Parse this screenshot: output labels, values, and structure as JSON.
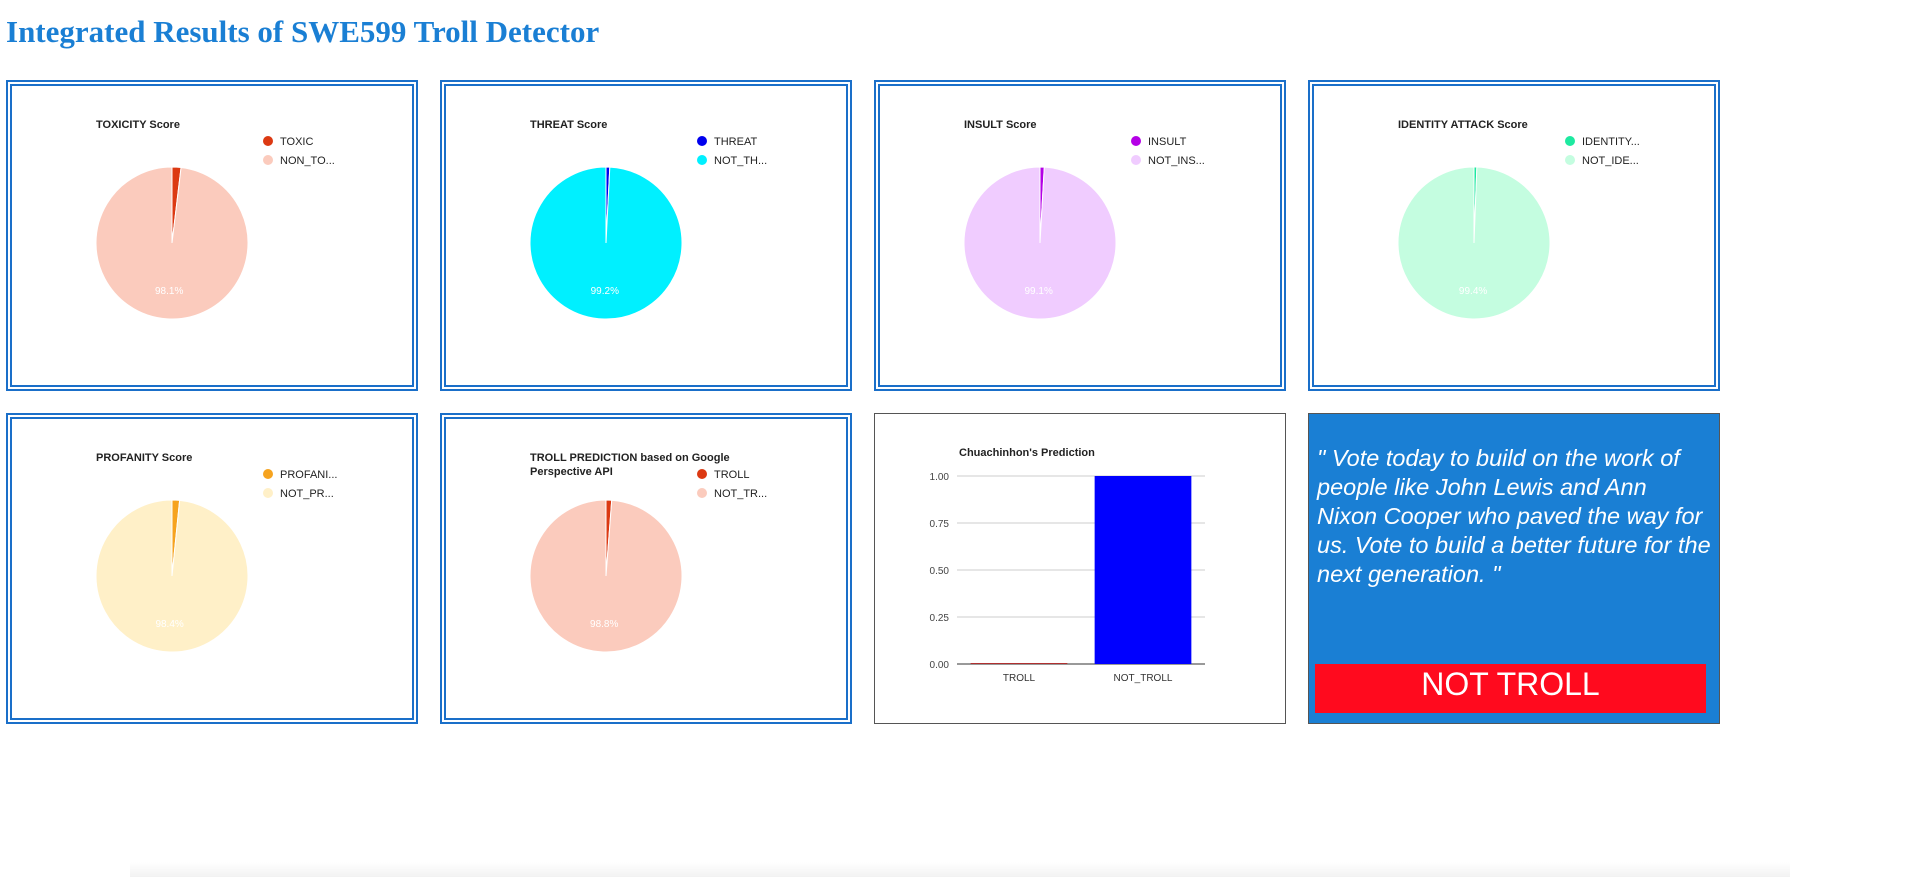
{
  "page": {
    "title": "Integrated Results of SWE599 Troll Detector"
  },
  "chart_data": [
    {
      "type": "pie",
      "title": "TOXICITY Score",
      "labels": [
        "TOXIC",
        "NON_TO..."
      ],
      "values": [
        1.9,
        98.1
      ],
      "colors": [
        "#dc3912",
        "#fbcbbd"
      ],
      "slice_labels": [
        "",
        "98.1%"
      ]
    },
    {
      "type": "pie",
      "title": "THREAT Score",
      "labels": [
        "THREAT",
        "NOT_TH..."
      ],
      "values": [
        0.8,
        99.2
      ],
      "colors": [
        "#0000ee",
        "#00f0ff"
      ],
      "slice_labels": [
        "",
        "99.2%"
      ]
    },
    {
      "type": "pie",
      "title": "INSULT Score",
      "labels": [
        "INSULT",
        "NOT_INS..."
      ],
      "values": [
        0.9,
        99.1
      ],
      "colors": [
        "#b400e6",
        "#f0ccff"
      ],
      "slice_labels": [
        "",
        "99.1%"
      ]
    },
    {
      "type": "pie",
      "title": "IDENTITY ATTACK Score",
      "labels": [
        "IDENTITY...",
        "NOT_IDE..."
      ],
      "values": [
        0.6,
        99.4
      ],
      "colors": [
        "#1de9a0",
        "#c4fde0"
      ],
      "slice_labels": [
        "",
        "99.4%"
      ]
    },
    {
      "type": "pie",
      "title": "PROFANITY Score",
      "labels": [
        "PROFANI...",
        "NOT_PR..."
      ],
      "values": [
        1.6,
        98.4
      ],
      "colors": [
        "#f6a31f",
        "#fff0c8"
      ],
      "slice_labels": [
        "",
        "98.4%"
      ]
    },
    {
      "type": "pie",
      "title_lines": [
        "TROLL PREDICTION based on Google",
        "Perspective API"
      ],
      "labels": [
        "TROLL",
        "NOT_TR..."
      ],
      "values": [
        1.2,
        98.8
      ],
      "colors": [
        "#dc3912",
        "#fbcbbd"
      ],
      "slice_labels": [
        "",
        "98.8%"
      ]
    },
    {
      "type": "bar",
      "title": "Chuachinhon's Prediction",
      "categories": [
        "TROLL",
        "NOT_TROLL"
      ],
      "values": [
        0.005,
        1.0
      ],
      "colors": [
        "#b03030",
        "#0000ff"
      ],
      "ylim": [
        0,
        1.0
      ],
      "yticks": [
        "0.00",
        "0.25",
        "0.50",
        "0.75",
        "1.00"
      ],
      "xlabel": "",
      "ylabel": "",
      "grid": true
    }
  ],
  "quote": {
    "text": "\" Vote today to build on the work of people like John Lewis and Ann Nixon Cooper who paved the way for us. Vote to build a better future for the next generation. \"",
    "verdict": "NOT TROLL",
    "bg_color": "#1a7fd4",
    "verdict_color": "#ff0a1e"
  }
}
